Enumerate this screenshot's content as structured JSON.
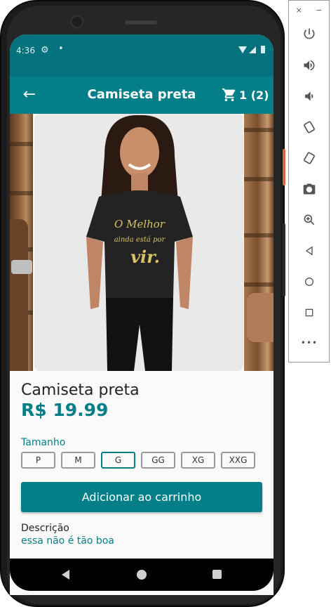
{
  "status_bar": {
    "time": "4:36",
    "gear_icon": "⚙",
    "dot": "•"
  },
  "app_bar": {
    "back_icon": "←",
    "title": "Camiseta preta",
    "cart_count": "1 (2)"
  },
  "product": {
    "shirt_text_1": "O Melhor",
    "shirt_text_2": "ainda está por",
    "shirt_text_3": "vir.",
    "name": "Camiseta preta",
    "price": "R$ 19.99",
    "size_label": "Tamanho",
    "sizes": [
      "P",
      "M",
      "G",
      "GG",
      "XG",
      "XXG"
    ],
    "selected_size": "G",
    "add_button": "Adicionar ao carrinho",
    "description_label": "Descrição",
    "description_text": "essa não é tão boa"
  },
  "toolbar": {
    "close": "×",
    "minimize": "−",
    "more": "•••",
    "icons": [
      "power-icon",
      "volume-up-icon",
      "volume-down-icon",
      "rotate-left-icon",
      "rotate-right-icon",
      "camera-icon",
      "zoom-icon",
      "back-icon",
      "home-icon",
      "overview-icon",
      "more-icon"
    ]
  },
  "colors": {
    "primary": "#047f8a",
    "status": "#03727d",
    "background": "#fafafa"
  }
}
